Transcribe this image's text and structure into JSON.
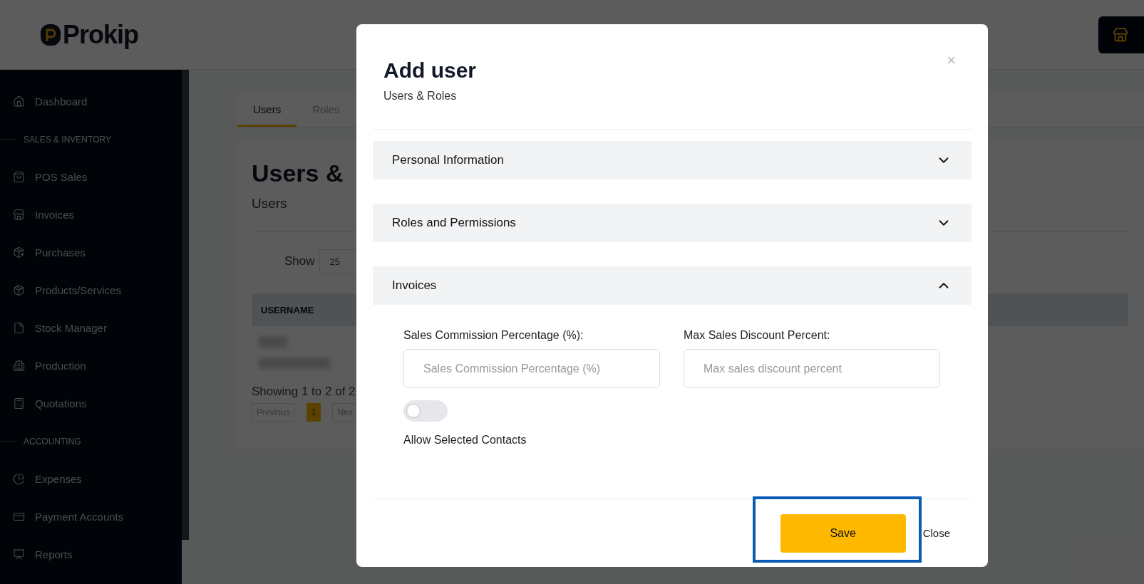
{
  "header": {
    "logo": "Prokip"
  },
  "sidebar": {
    "items": [
      {
        "kind": "item",
        "label": "Dashboard"
      },
      {
        "kind": "section",
        "label": "SALES & INVENTORY"
      },
      {
        "kind": "item",
        "label": "POS Sales"
      },
      {
        "kind": "item",
        "label": "Invoices"
      },
      {
        "kind": "item",
        "label": "Purchases"
      },
      {
        "kind": "item",
        "label": "Products/Services"
      },
      {
        "kind": "item",
        "label": "Stock Manager"
      },
      {
        "kind": "item",
        "label": "Production"
      },
      {
        "kind": "item",
        "label": "Quotations"
      },
      {
        "kind": "section",
        "label": "ACCOUNTING"
      },
      {
        "kind": "item",
        "label": "Expenses"
      },
      {
        "kind": "item",
        "label": "Payment Accounts"
      },
      {
        "kind": "item",
        "label": "Reports"
      }
    ]
  },
  "tabs": [
    {
      "label": "Users",
      "selected": true
    },
    {
      "label": "Roles",
      "selected": false
    }
  ],
  "main_card": {
    "title": "Users &",
    "subtitle": "Users",
    "show_label": "Show",
    "page_size": "25",
    "column": "USERNAME",
    "info": "Showing 1 to 2 of 2",
    "pages": [
      {
        "label": "Previous",
        "selected": false
      },
      {
        "label": "1",
        "selected": true
      },
      {
        "label": "Nex",
        "selected": false
      }
    ]
  },
  "modal": {
    "title": "Add user",
    "subtitle": "Users & Roles",
    "close_icon": "×",
    "sections": [
      {
        "title": "Personal Information",
        "expanded": false
      },
      {
        "title": "Roles and Permissions",
        "expanded": false
      },
      {
        "title": "Invoices",
        "expanded": true,
        "fields": [
          {
            "label": "Sales Commission Percentage (%):",
            "placeholder": "Sales Commission Percentage (%)"
          },
          {
            "label": "Max Sales Discount Percent:",
            "placeholder": "Max sales discount percent"
          }
        ],
        "toggle": {
          "label": "Allow Selected Contacts",
          "on": false
        }
      }
    ],
    "save": "Save",
    "close": "Close"
  }
}
